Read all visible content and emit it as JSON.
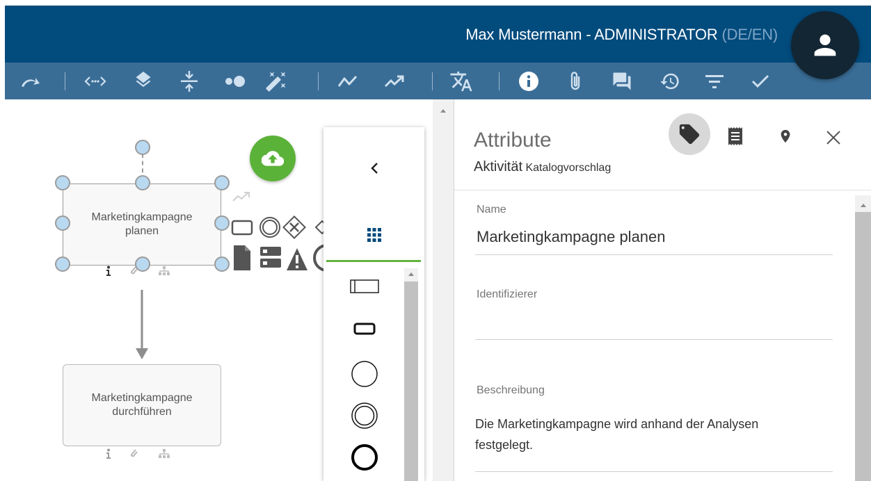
{
  "header": {
    "user_label": "Max Mustermann - ADMINISTRATOR",
    "lang_label": "(DE/EN)"
  },
  "toolbar": {
    "icons": [
      "redo-icon",
      "horizontal-spacing-icon",
      "layers-icon",
      "vertical-spacing-icon",
      "dots-icon",
      "magic-wand-icon",
      "line-chart-icon",
      "trending-icon",
      "translate-icon",
      "info-icon",
      "attachment-icon",
      "comments-icon",
      "history-icon",
      "filter-icon",
      "check-icon"
    ]
  },
  "canvas": {
    "node1_label": "Marketingkampagne planen",
    "node2_label": "Marketingkampagne durchführen"
  },
  "palette": {
    "icons": [
      "chevron-left-icon",
      "grid-icon",
      "lane-shape-icon",
      "task-shape-icon",
      "start-event-icon",
      "intermediate-event-icon",
      "end-event-icon"
    ]
  },
  "panel": {
    "title": "Attribute",
    "subtitle_type": "Aktivität",
    "subtitle_catalog": "Katalogvorschlag",
    "fields": {
      "name_label": "Name",
      "name_value": "Marketingkampagne planen",
      "identifier_label": "Identifizierer",
      "identifier_value": "",
      "description_label": "Beschreibung",
      "description_value": "Die Marketingkampagne wird anhand der Analysen festgelegt."
    }
  },
  "colors": {
    "header_bg": "#024b7d",
    "toolbar_bg": "#3a6d96",
    "accent_green": "#5bb238"
  }
}
